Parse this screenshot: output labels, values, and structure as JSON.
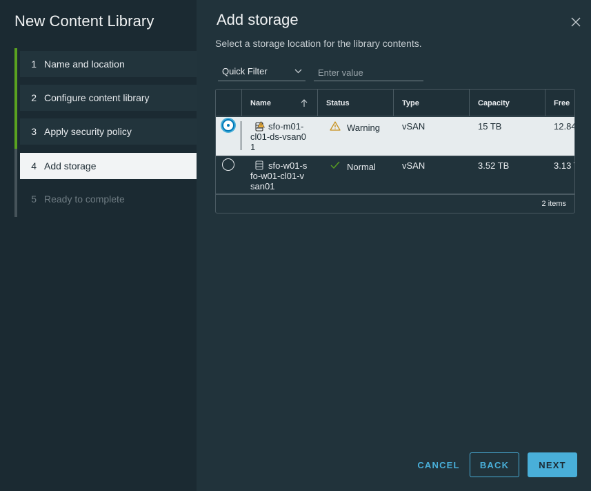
{
  "wizard": {
    "title": "New Content Library",
    "steps": [
      {
        "num": "1",
        "label": "Name and location",
        "state": "done"
      },
      {
        "num": "2",
        "label": "Configure content library",
        "state": "done"
      },
      {
        "num": "3",
        "label": "Apply security policy",
        "state": "done"
      },
      {
        "num": "4",
        "label": "Add storage",
        "state": "current"
      },
      {
        "num": "5",
        "label": "Ready to complete",
        "state": "disabled"
      }
    ]
  },
  "page": {
    "title": "Add storage",
    "subtitle": "Select a storage location for the library contents.",
    "close_icon": "close-icon"
  },
  "filter": {
    "quick_filter_label": "Quick Filter",
    "input_placeholder": "Enter value"
  },
  "grid": {
    "columns": [
      "Name",
      "Status",
      "Type",
      "Capacity",
      "Free"
    ],
    "sorted_column": "Name",
    "sort_direction": "ascending",
    "rows": [
      {
        "selected": true,
        "name": "sfo-m01-cl01-ds-vsan01",
        "name_lines": [
          "sfo-m01-",
          "cl01-ds-vsan0",
          "1"
        ],
        "status": "Warning",
        "status_icon": "warning-icon",
        "type": "vSAN",
        "capacity": "15 TB",
        "free": "12.84"
      },
      {
        "selected": false,
        "name": "sfo-w01-sfo-w01-cl01-vsan01",
        "name_lines": [
          "sfo-w01-s",
          "fo-w01-cl01-v",
          "san01"
        ],
        "status": "Normal",
        "status_icon": "check-icon",
        "type": "vSAN",
        "capacity": "3.52 TB",
        "free": "3.13 T"
      }
    ],
    "footer": "2 items"
  },
  "buttons": {
    "cancel": "CANCEL",
    "back": "BACK",
    "next": "NEXT"
  },
  "colors": {
    "accent": "#49afd9",
    "progress": "#5aa220",
    "warning": "#f2b23a",
    "ok": "#5aa220"
  }
}
